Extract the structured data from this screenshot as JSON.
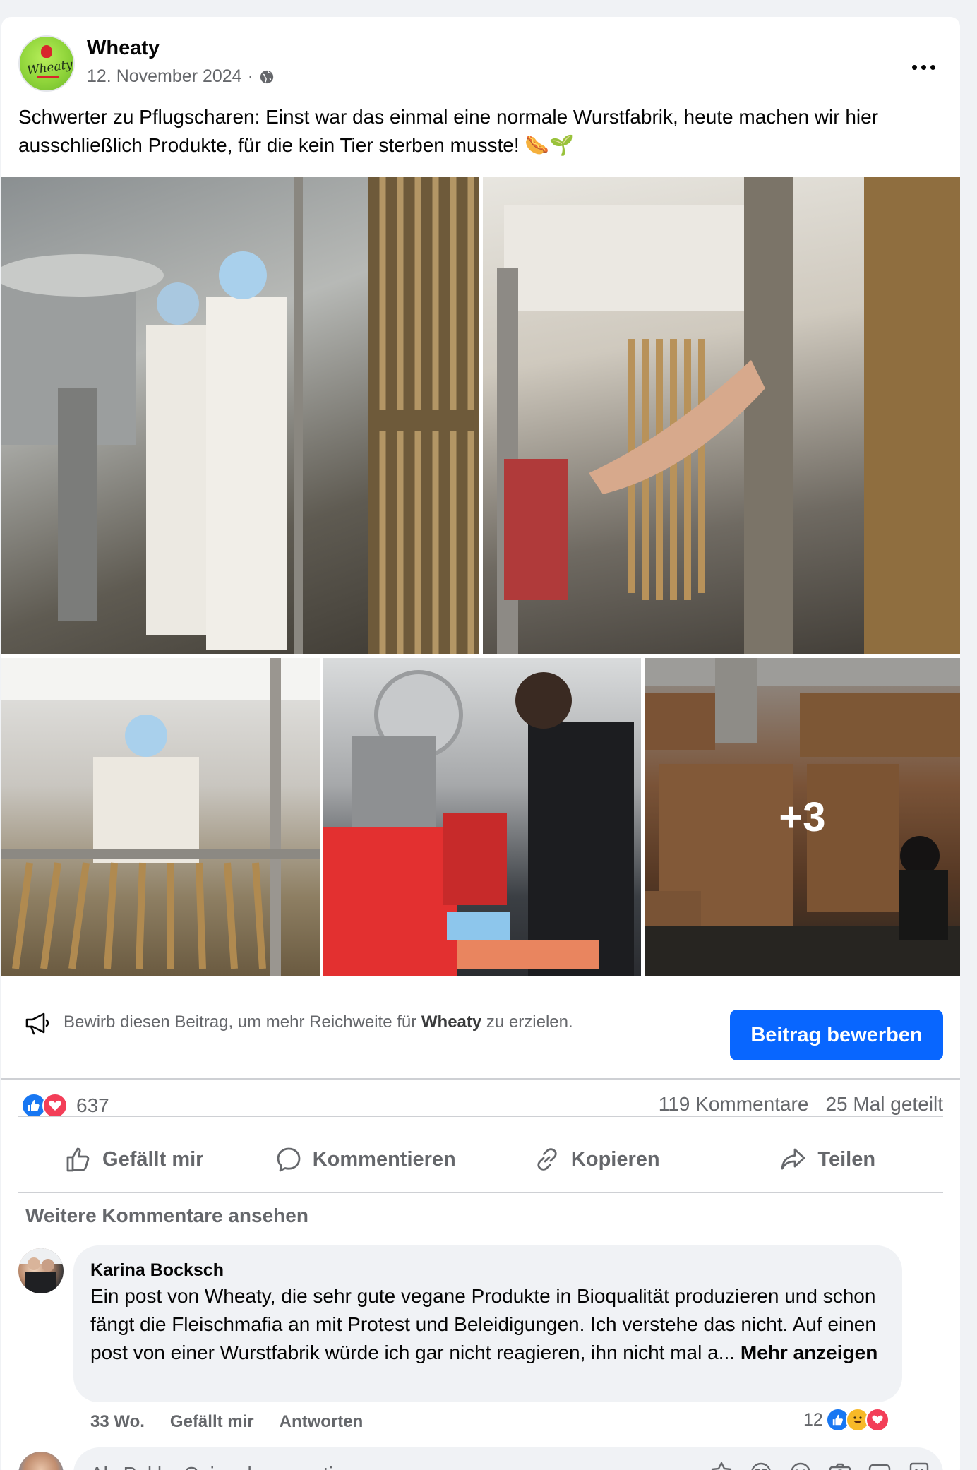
{
  "post": {
    "page_name": "Wheaty",
    "logo_text": "Wheaty",
    "date": "12. November 2024",
    "separator": "·",
    "text": "Schwerter zu Pflugscharen: Einst war das einmal eine normale Wurstfabrik, heute machen wir hier ausschließlich Produkte, für die kein Tier sterben musste! 🌭🌱",
    "more_photos_label": "+3",
    "photos": [
      {
        "icon": "factory-workers-photo"
      },
      {
        "icon": "sausage-rack-photo"
      },
      {
        "icon": "worker-sausages-photo"
      },
      {
        "icon": "packaging-worker-photo"
      },
      {
        "icon": "warehouse-photo"
      }
    ]
  },
  "promote": {
    "text_before": "Bewirb diesen Beitrag, um mehr Reichweite für ",
    "text_bold": "Wheaty",
    "text_after": " zu erzielen.",
    "button_label": "Beitrag bewerben",
    "button_color": "#0866ff"
  },
  "stats": {
    "reaction_count": "637",
    "comments": "119 Kommentare",
    "shares": "25 Mal geteilt"
  },
  "actions": {
    "like": "Gefällt mir",
    "comment": "Kommentieren",
    "copy": "Kopieren",
    "share": "Teilen"
  },
  "comments": {
    "more_label": "Weitere Kommentare ansehen",
    "items": [
      {
        "author": "Karina Bocksch",
        "text": "Ein post von Wheaty, die sehr gute vegane Produkte in Bioqualität produzieren und schon fängt die Fleischmafia an mit Protest und Beleidigungen. Ich verstehe das nicht. Auf einen post von einer Wurstfabrik würde ich gar nicht reagieren, ihn nicht mal a...",
        "see_more": "Mehr anzeigen",
        "time": "33 Wo.",
        "like_label": "Gefällt mir",
        "reply_label": "Antworten",
        "reaction_count": "12"
      }
    ]
  },
  "compose": {
    "placeholder": "Als Pekka Gaiser kommentieren"
  },
  "colors": {
    "accent": "#0866ff",
    "like": "#1877f2",
    "love": "#f33e58",
    "haha": "#f7b928"
  }
}
